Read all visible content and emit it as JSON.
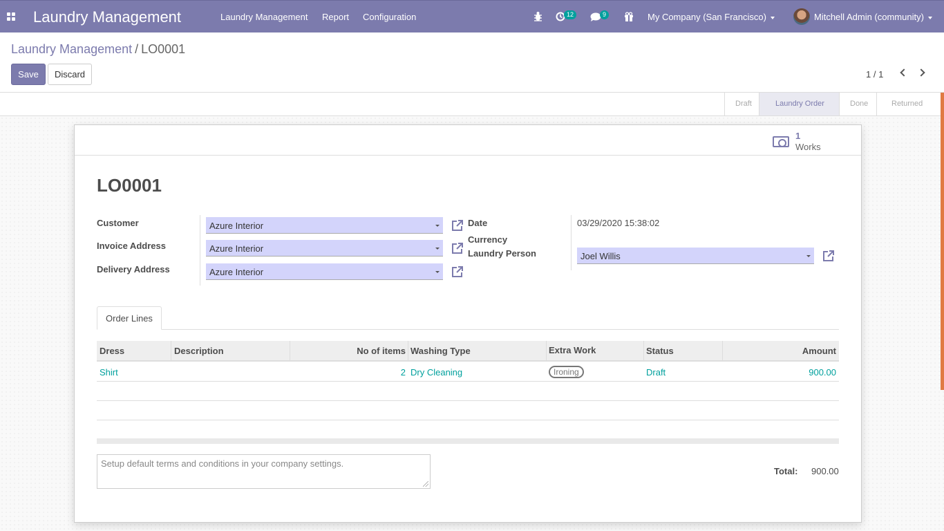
{
  "navbar": {
    "app_title": "Laundry Management",
    "menus": [
      "Laundry Management",
      "Report",
      "Configuration"
    ],
    "activity_count": "12",
    "message_count": "9",
    "company": "My Company (San Francisco)",
    "user": "Mitchell Admin (community)"
  },
  "breadcrumb": {
    "parent": "Laundry Management",
    "separator": "/",
    "current": "LO0001"
  },
  "actions": {
    "save": "Save",
    "discard": "Discard"
  },
  "pager": {
    "value": "1 / 1"
  },
  "statusbar": {
    "stages": [
      "Draft",
      "Laundry Order",
      "Done",
      "Returned"
    ],
    "active": "Laundry Order"
  },
  "smart_button": {
    "value": "1",
    "label": "Works"
  },
  "form": {
    "title": "LO0001",
    "customer_label": "Customer",
    "customer": "Azure Interior",
    "invoice_label": "Invoice Address",
    "invoice": "Azure Interior",
    "delivery_label": "Delivery Address",
    "delivery": "Azure Interior",
    "date_label": "Date",
    "date": "03/29/2020 15:38:02",
    "currency_label": "Currency",
    "person_label": "Laundry Person",
    "person": "Joel Willis"
  },
  "notebook": {
    "tab": "Order Lines"
  },
  "order_lines": {
    "headers": [
      "Dress",
      "Description",
      "No of items",
      "Washing Type",
      "Extra Work",
      "Status",
      "Amount"
    ],
    "rows": [
      {
        "dress": "Shirt",
        "description": "",
        "items": "2",
        "washing": "Dry Cleaning",
        "extra": "Ironing",
        "status": "Draft",
        "amount": "900.00"
      }
    ]
  },
  "terms_placeholder": "Setup default terms and conditions in your company settings.",
  "totals": {
    "label": "Total:",
    "value": "900.00"
  },
  "colors": {
    "primary": "#7c7bad",
    "teal": "#00a09d",
    "field_bg": "#d3d4fb"
  }
}
